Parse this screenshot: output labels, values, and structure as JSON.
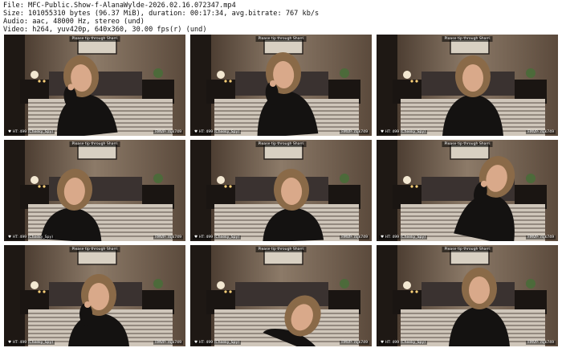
{
  "header": {
    "file": "File: MFC-Public.Show-f-AlanaWylde-2026.02.16.072347.mp4",
    "size": "Size: 101055310 bytes (96.37 MiB), duration: 00:17:34, avg.bitrate: 767 kb/s",
    "audio": "Audio: aac, 48000 Hz, stereo (und)",
    "video": "Video: h264, yuv420p, 640x360, 30.00 fps(r) (und)"
  },
  "frames": [
    {
      "top_text": "Please tip through Sharri",
      "bottom_left": "♥ HT: 499 (Cheeky_Spy)",
      "bottom_right": "FMVP- mjk749"
    },
    {
      "top_text": "Please tip through Sharri",
      "bottom_left": "♥ HT: 499 (Cheeky_Spy)",
      "bottom_right": "FMVP- mjk749"
    },
    {
      "top_text": "Please tip through Sharri",
      "bottom_left": "♥ HT: 499 (Cheeky_Spy)",
      "bottom_right": "FMVP- mjk749"
    },
    {
      "top_text": "Please tip through Sharri",
      "bottom_left": "♥ HT: 499 (Cheeky_Spy)",
      "bottom_right": "FMVP- mjk749"
    },
    {
      "top_text": "Please tip through Sharri",
      "bottom_left": "♥ HT: 499 (Cheeky_Spy)",
      "bottom_right": "FMVP- mjk749"
    },
    {
      "top_text": "Please tip through Sharri",
      "bottom_left": "♥ HT: 499 (Cheeky_Spy)",
      "bottom_right": "FMVP- mjk749"
    },
    {
      "top_text": "Please tip through Sharri",
      "bottom_left": "♥ HT: 499 (Cheeky_Spy)",
      "bottom_right": "FMVP- mjk749"
    },
    {
      "top_text": "Please tip through Sharri",
      "bottom_left": "♥ HT: 499 (Cheeky_Spy)",
      "bottom_right": "FMVP- mjk749"
    },
    {
      "top_text": "Please tip through Sharri",
      "bottom_left": "♥ HT: 499 (Cheeky_Spy)",
      "bottom_right": "FMVP- mjk749"
    }
  ]
}
